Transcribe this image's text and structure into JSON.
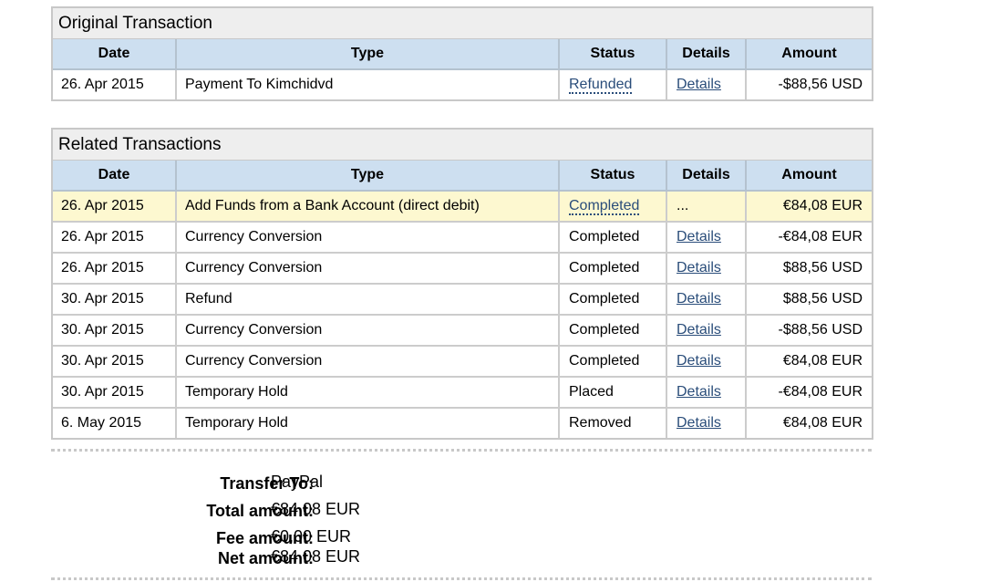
{
  "columns": [
    "Date",
    "Type",
    "Status",
    "Details",
    "Amount"
  ],
  "original": {
    "title": "Original Transaction",
    "rows": [
      {
        "date": "26. Apr 2015",
        "type": "Payment To Kimchidvd",
        "status": "Refunded",
        "details": "Details",
        "amount": "-$88,56 USD"
      }
    ]
  },
  "related": {
    "title": "Related Transactions",
    "rows": [
      {
        "date": "26. Apr 2015",
        "type": "Add Funds from a Bank Account (direct debit)",
        "status": "Completed",
        "details": "...",
        "amount": "€84,08 EUR"
      },
      {
        "date": "26. Apr 2015",
        "type": "Currency Conversion",
        "status": "Completed",
        "details": "Details",
        "amount": "-€84,08 EUR"
      },
      {
        "date": "26. Apr 2015",
        "type": "Currency Conversion",
        "status": "Completed",
        "details": "Details",
        "amount": "$88,56 USD"
      },
      {
        "date": "30. Apr 2015",
        "type": "Refund",
        "status": "Completed",
        "details": "Details",
        "amount": "$88,56 USD"
      },
      {
        "date": "30. Apr 2015",
        "type": "Currency Conversion",
        "status": "Completed",
        "details": "Details",
        "amount": "-$88,56 USD"
      },
      {
        "date": "30. Apr 2015",
        "type": "Currency Conversion",
        "status": "Completed",
        "details": "Details",
        "amount": "€84,08 EUR"
      },
      {
        "date": "30. Apr 2015",
        "type": "Temporary Hold",
        "status": "Placed",
        "details": "Details",
        "amount": "-€84,08 EUR"
      },
      {
        "date": "6. May 2015",
        "type": "Temporary Hold",
        "status": "Removed",
        "details": "Details",
        "amount": "€84,08 EUR"
      }
    ]
  },
  "summary": {
    "transfer_to_label": "Transfer To:",
    "transfer_to": "PayPal",
    "total_label": "Total amount:",
    "total": "€84,08 EUR",
    "fee_label": "Fee amount:",
    "fee": "€0,00 EUR",
    "net_label": "Net amount:",
    "net": "€84,08 EUR"
  }
}
